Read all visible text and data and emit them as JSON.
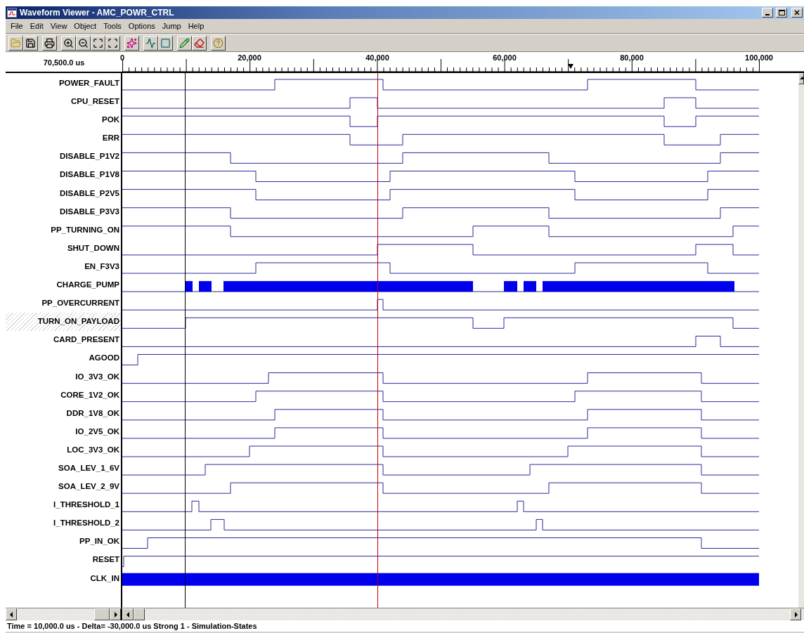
{
  "window": {
    "title": "Waveform Viewer - AMC_POWR_CTRL"
  },
  "menu": [
    "File",
    "Edit",
    "View",
    "Object",
    "Tools",
    "Options",
    "Jump",
    "Help"
  ],
  "ruler": {
    "cursor_time": "70,500.0 us",
    "labels": [
      "0",
      "20,000",
      "40,000",
      "60,000",
      "80,000",
      "100,000"
    ]
  },
  "signals": [
    {
      "name": "POWER_FAULT",
      "selected": false
    },
    {
      "name": "CPU_RESET",
      "selected": false
    },
    {
      "name": "POK",
      "selected": false
    },
    {
      "name": "ERR",
      "selected": false
    },
    {
      "name": "DISABLE_P1V2",
      "selected": false
    },
    {
      "name": "DISABLE_P1V8",
      "selected": false
    },
    {
      "name": "DISABLE_P2V5",
      "selected": false
    },
    {
      "name": "DISABLE_P3V3",
      "selected": false
    },
    {
      "name": "PP_TURNING_ON",
      "selected": false
    },
    {
      "name": "SHUT_DOWN",
      "selected": false
    },
    {
      "name": "EN_F3V3",
      "selected": false
    },
    {
      "name": "CHARGE_PUMP",
      "selected": false
    },
    {
      "name": "PP_OVERCURRENT",
      "selected": false
    },
    {
      "name": "TURN_ON_PAYLOAD",
      "selected": true
    },
    {
      "name": "CARD_PRESENT",
      "selected": false
    },
    {
      "name": "AGOOD",
      "selected": false
    },
    {
      "name": "IO_3V3_OK",
      "selected": false
    },
    {
      "name": "CORE_1V2_OK",
      "selected": false
    },
    {
      "name": "DDR_1V8_OK",
      "selected": false
    },
    {
      "name": "IO_2V5_OK",
      "selected": false
    },
    {
      "name": "LOC_3V3_OK",
      "selected": false
    },
    {
      "name": "SOA_LEV_1_6V",
      "selected": false
    },
    {
      "name": "SOA_LEV_2_9V",
      "selected": false
    },
    {
      "name": "I_THRESHOLD_1",
      "selected": false
    },
    {
      "name": "I_THRESHOLD_2",
      "selected": false
    },
    {
      "name": "PP_IN_OK",
      "selected": false
    },
    {
      "name": "RESET",
      "selected": false
    },
    {
      "name": "CLK_IN",
      "selected": false
    }
  ],
  "status_bar": "Time = 10,000.0 us - Delta= -30,000.0 us Strong 1 - Simulation-States"
}
